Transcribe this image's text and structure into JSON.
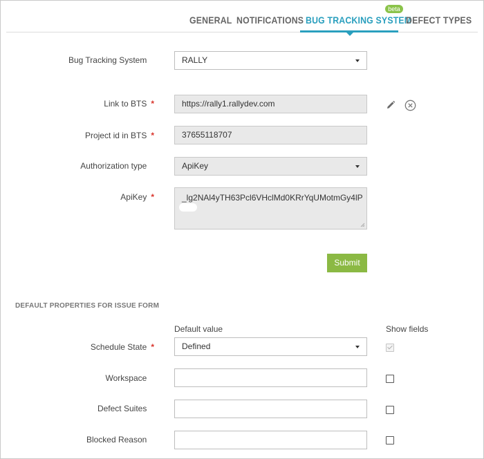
{
  "tabs": {
    "general": "GENERAL",
    "notifications": "NOTIFICATIONS",
    "bug_tracking": "BUG TRACKING SYSTEM",
    "defect_types": "DEFECT TYPES",
    "beta_badge": "beta",
    "active": "BUG TRACKING SYSTEM"
  },
  "bts_form": {
    "bug_tracking_system": {
      "label": "Bug Tracking System",
      "value": "RALLY"
    },
    "link_to_bts": {
      "label": "Link to BTS",
      "value": "https://rally1.rallydev.com",
      "required": true
    },
    "project_id": {
      "label": "Project id in BTS",
      "value": "37655118707",
      "required": true
    },
    "authorization_type": {
      "label": "Authorization type",
      "value": "ApiKey"
    },
    "api_key": {
      "label": "ApiKey",
      "value": "_lg2NAl4yTH63Pcl6VHclMd0KRrYqUMotmGy4lP",
      "required": true
    },
    "submit_label": "Submit",
    "icons": {
      "edit": "pencil-icon",
      "remove": "circle-x-icon"
    }
  },
  "issue_form": {
    "section_title": "DEFAULT PROPERTIES FOR ISSUE FORM",
    "default_value_header": "Default value",
    "show_fields_header": "Show fields",
    "rows": [
      {
        "label": "Schedule State",
        "required": true,
        "value": "Defined",
        "type": "select",
        "show": true,
        "show_disabled": true
      },
      {
        "label": "Workspace",
        "required": false,
        "value": "",
        "type": "text",
        "show": false
      },
      {
        "label": "Defect Suites",
        "required": false,
        "value": "",
        "type": "text",
        "show": false
      },
      {
        "label": "Blocked Reason",
        "required": false,
        "value": "",
        "type": "text",
        "show": false
      }
    ]
  },
  "colors": {
    "accent": "#2a9fbe",
    "submit": "#8bb944",
    "beta": "#8bc34a",
    "required": "#d9342b"
  }
}
